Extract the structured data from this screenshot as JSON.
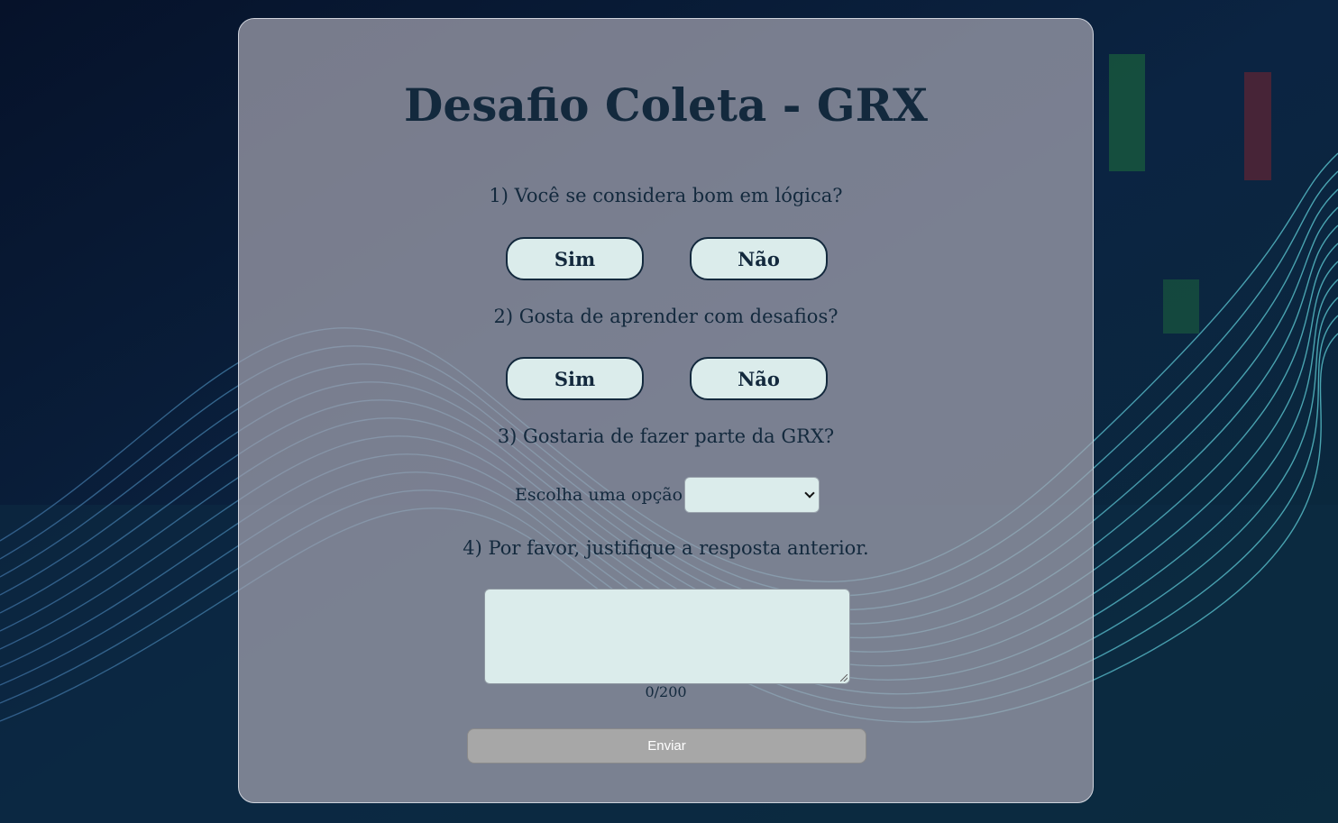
{
  "page": {
    "title": "Desafio Coleta - GRX"
  },
  "questions": [
    {
      "label": "1) Você se considera bom em lógica?",
      "options": [
        "Sim",
        "Não"
      ]
    },
    {
      "label": "2) Gosta de aprender com desafios?",
      "options": [
        "Sim",
        "Não"
      ]
    },
    {
      "label": "3) Gostaria de fazer parte da GRX?",
      "select_label": "Escolha uma opção:",
      "selected_value": ""
    },
    {
      "label": "4) Por favor, justifique a resposta anterior.",
      "value": "",
      "counter": "0/200"
    }
  ],
  "submit": {
    "label": "Enviar",
    "state": "disabled"
  },
  "colors": {
    "text": "#13293d",
    "button_bg": "#dbeceb",
    "card_bg": "rgba(165,164,176,0.72)",
    "submit_bg": "#a7a7a7",
    "page_bg": "#06142e"
  }
}
